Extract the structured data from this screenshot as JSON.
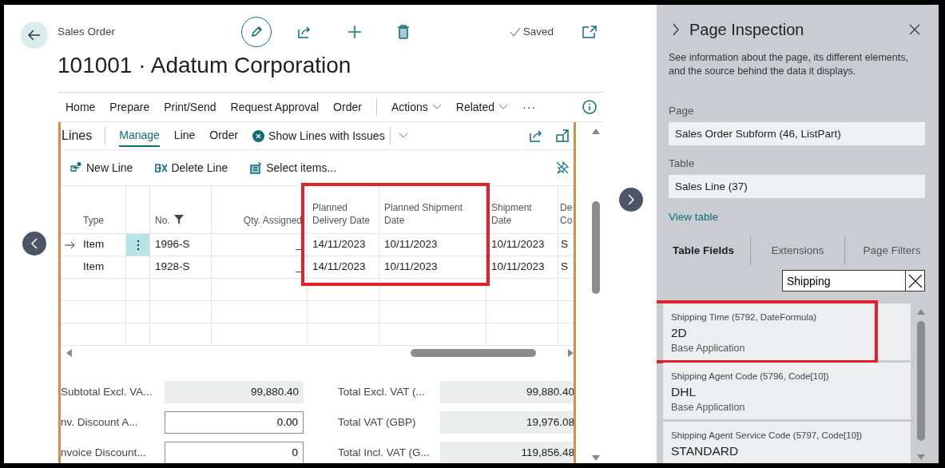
{
  "header": {
    "caption": "Sales Order",
    "title": "101001 · Adatum Corporation",
    "status": "Saved"
  },
  "action_bar": [
    {
      "label": "Home",
      "kind": "tab"
    },
    {
      "label": "Prepare",
      "kind": "tab"
    },
    {
      "label": "Print/Send",
      "kind": "tab"
    },
    {
      "label": "Request Approval",
      "kind": "tab"
    },
    {
      "label": "Order",
      "kind": "tab"
    },
    {
      "label": "Actions",
      "kind": "menu"
    },
    {
      "label": "Related",
      "kind": "menu"
    },
    {
      "label": "···",
      "kind": "more"
    }
  ],
  "lines": {
    "title": "Lines",
    "tabs": [
      {
        "label": "Manage",
        "selected": true
      },
      {
        "label": "Line",
        "selected": false
      },
      {
        "label": "Order",
        "selected": false
      }
    ],
    "filter_action": "Show Lines with Issues",
    "actions": [
      {
        "label": "New Line",
        "kind": "new"
      },
      {
        "label": "Delete Line",
        "kind": "delete"
      },
      {
        "label": "Select items...",
        "kind": "select"
      }
    ]
  },
  "table": {
    "columns": [
      {
        "kind": "text",
        "label": "Type",
        "filtered": false,
        "highlighted": false
      },
      {
        "kind": "text",
        "label": "No.",
        "filtered": true,
        "highlighted": false
      },
      {
        "kind": "number",
        "label": "Qty. Assigned",
        "filtered": false,
        "highlighted": false
      },
      {
        "kind": "text",
        "label": "Planned Delivery Date",
        "filtered": false,
        "highlighted": true
      },
      {
        "kind": "text",
        "label": "Planned Shipment Date",
        "filtered": false,
        "highlighted": true
      },
      {
        "kind": "text",
        "label": "Shipment Date",
        "filtered": false,
        "highlighted": false
      },
      {
        "kind": "text",
        "label": "De Co",
        "filtered": false,
        "highlighted": false
      }
    ],
    "rows": [
      {
        "current": true,
        "cells": [
          "Item",
          "1996-S",
          "_",
          "14/11/2023",
          "10/11/2023",
          "10/11/2023",
          "S"
        ]
      },
      {
        "current": false,
        "cells": [
          "Item",
          "1928-S",
          "_",
          "14/11/2023",
          "10/11/2023",
          "10/11/2023",
          "S"
        ]
      }
    ]
  },
  "totals": {
    "left": [
      {
        "label": "Subtotal Excl. VA...",
        "value": "99,880.40",
        "editable": false
      },
      {
        "label": "nv. Discount A...",
        "value": "0.00",
        "editable": true
      },
      {
        "label": "nvoice Discount...",
        "value": "0",
        "editable": true
      }
    ],
    "right": [
      {
        "label": "Total Excl. VAT (...",
        "value": "99,880.40",
        "editable": false
      },
      {
        "label": "Total VAT (GBP)",
        "value": "19,976.08",
        "editable": false
      },
      {
        "label": "Total Incl. VAT (G...",
        "value": "119,856.48",
        "editable": false
      }
    ]
  },
  "inspector": {
    "title": "Page Inspection",
    "description": "See information about the page, its different elements, and the source behind the data it displays.",
    "page_label": "Page",
    "page_value": "Sales Order Subform (46, ListPart)",
    "table_label": "Table",
    "table_value": "Sales Line (37)",
    "link": "View table",
    "tabs": [
      {
        "label": "Table Fields",
        "selected": true
      },
      {
        "label": "Extensions",
        "selected": false
      },
      {
        "label": "Page Filters",
        "selected": false
      }
    ],
    "search": {
      "value": "Shipping"
    },
    "fields": [
      {
        "caption": "Shipping Time (5792, DateFormula)",
        "value": "2D",
        "source": "Base Application",
        "highlighted": true
      },
      {
        "caption": "Shipping Agent Code (5796, Code[10])",
        "value": "DHL",
        "source": "Base Application",
        "highlighted": false
      },
      {
        "caption": "Shipping Agent Service Code (5797, Code[10])",
        "value": "STANDARD",
        "highlighted": false
      }
    ]
  }
}
